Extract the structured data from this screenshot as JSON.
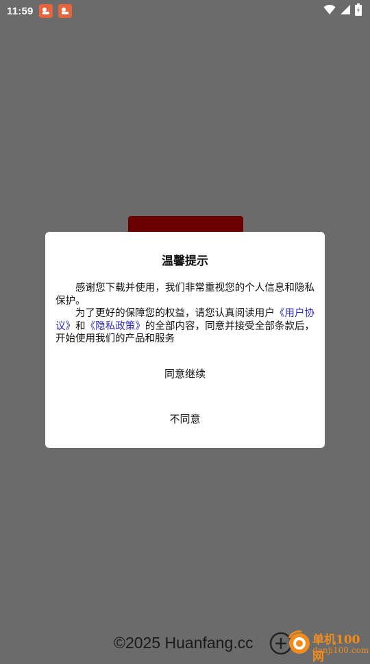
{
  "status_bar": {
    "time": "11:59",
    "notification_icons": [
      "app-notification-icon",
      "app-notification-icon"
    ],
    "right_icons": [
      "wifi-icon",
      "cell-signal-icon",
      "battery-icon"
    ]
  },
  "dialog": {
    "title": "温馨提示",
    "para1": "感谢您下载并使用，我们非常重视您的个人信息和隐私保护。",
    "para2_prefix": "为了更好的保障您的权益，请您认真阅读用户",
    "user_agreement_link": "《用户协议》",
    "and_text": "和",
    "privacy_policy_link": "《隐私政策》",
    "para2_suffix": "的全部内容，同意并接受全部条款后，开始使用我们的产品和服务",
    "agree_label": "同意继续",
    "disagree_label": "不同意"
  },
  "footer": {
    "copyright": "©2025 Huanfang.cc"
  },
  "watermark": {
    "title": "单机100网",
    "subtitle": "danji100.com"
  },
  "colors": {
    "overlay": "#6b6b6b",
    "link": "#2b2bb8",
    "background_button": "#6b0000",
    "watermark": "#f08c1e"
  }
}
